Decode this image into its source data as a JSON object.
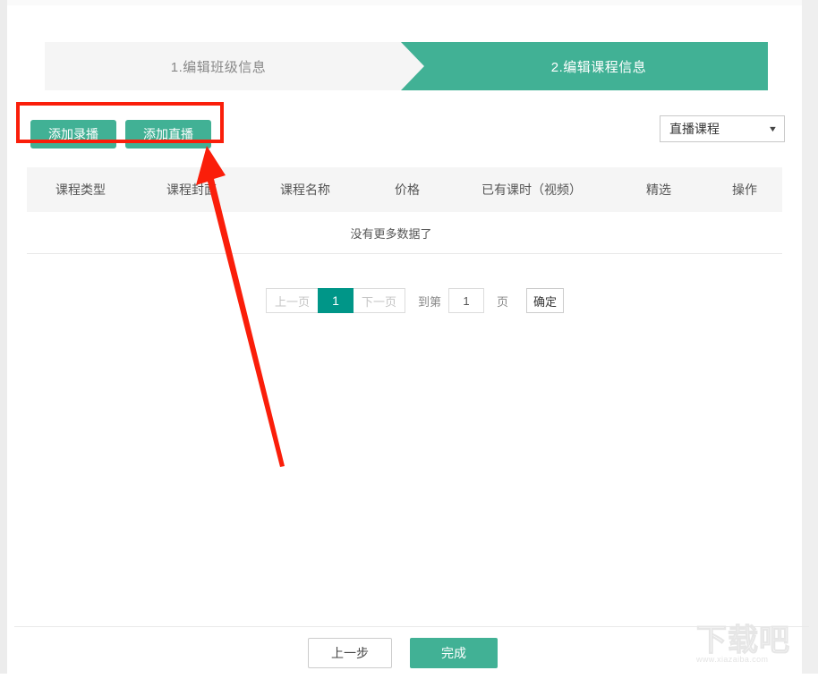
{
  "steps": [
    {
      "label": "1.编辑班级信息",
      "state": "inactive"
    },
    {
      "label": "2.编辑课程信息",
      "state": "active"
    }
  ],
  "toolbar": {
    "add_recorded_label": "添加录播",
    "add_live_label": "添加直播",
    "course_type_filter": {
      "value": "直播课程",
      "caret": "▼"
    }
  },
  "table": {
    "columns": [
      "课程类型",
      "课程封面",
      "课程名称",
      "价格",
      "已有课时（视频）",
      "精选",
      "操作"
    ],
    "rows": [],
    "empty_text": "没有更多数据了"
  },
  "pagination": {
    "prev_label": "上一页",
    "current_page": "1",
    "next_label": "下一页",
    "goto_prefix": "到第",
    "goto_value": "1",
    "goto_suffix": "页",
    "confirm_label": "确定"
  },
  "footer": {
    "prev_step_label": "上一步",
    "finish_label": "完成"
  },
  "watermark": {
    "text": "下载吧",
    "url": "www.xiazaiba.com"
  },
  "colors": {
    "brand_green": "#41b195",
    "page_active": "#009688",
    "annotation_red": "#fa1e0a",
    "header_grey": "#f5f5f5"
  }
}
